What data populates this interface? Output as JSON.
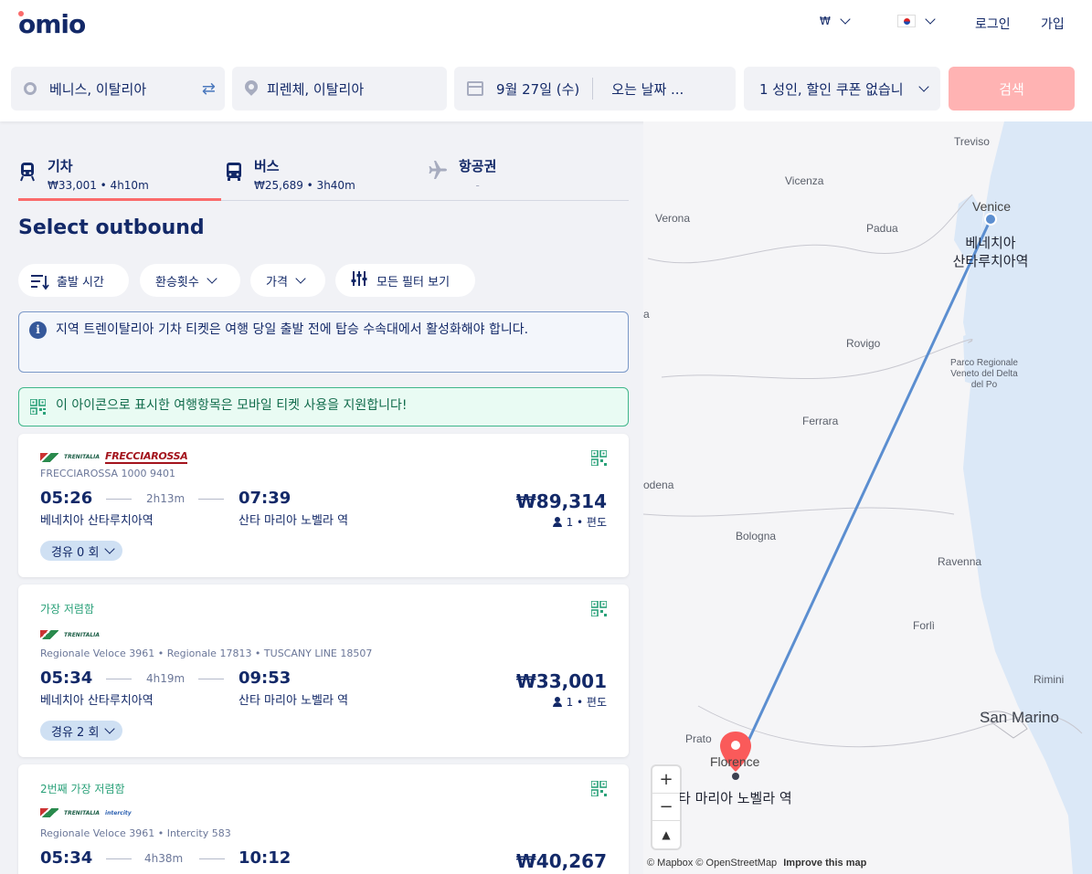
{
  "header": {
    "logo": "omio",
    "currency": "₩",
    "login": "로그인",
    "signup": "가입"
  },
  "search": {
    "origin": "베니스, 이탈리아",
    "destination": "피렌체, 이탈리아",
    "depart_date": "9월 27일 (수)",
    "return_date": "오는 날짜 ...",
    "passengers": "1 성인, 할인 쿠폰 없습니",
    "button": "검색"
  },
  "tabs": [
    {
      "label": "기차",
      "sub": "₩33,001 • 4h10m",
      "icon": "train-icon"
    },
    {
      "label": "버스",
      "sub": "₩25,689 • 3h40m",
      "icon": "bus-icon"
    },
    {
      "label": "항공권",
      "sub": "-",
      "icon": "plane-icon"
    }
  ],
  "section_title": "Select outbound",
  "filters": {
    "departure_time": "출발 시간",
    "transfers": "환승횟수",
    "price": "가격",
    "all_filters": "모든 필터 보기"
  },
  "notices": {
    "info": "지역 트렌이탈리아 기차 티켓은 여행 당일 출발 전에 탑승 수속대에서 활성화해야 합니다.",
    "mobile": "이 아이콘으로 표시한 여행항목은 모바일 티켓 사용을 지원합니다!"
  },
  "results": [
    {
      "tag": "",
      "operator": "FRECCIAROSSA",
      "train": "FRECCIAROSSA 1000 9401",
      "depart": "05:26",
      "duration": "2h13m",
      "arrive": "07:39",
      "from": "베네치아 산타루치아역",
      "to": "산타 마리아 노벨라 역",
      "price": "₩89,314",
      "pax": "1 • 편도",
      "stops": "경유 0 회"
    },
    {
      "tag": "가장 저렴함",
      "operator": "",
      "train": "Regionale Veloce 3961 • Regionale 17813 • TUSCANY LINE 18507",
      "depart": "05:34",
      "duration": "4h19m",
      "arrive": "09:53",
      "from": "베네치아 산타루치아역",
      "to": "산타 마리아 노벨라 역",
      "price": "₩33,001",
      "pax": "1 • 편도",
      "stops": "경유 2 회"
    },
    {
      "tag": "2번째 가장 저렴함",
      "operator": "",
      "train": "Regionale Veloce 3961 • Intercity 583",
      "depart": "05:34",
      "duration": "4h38m",
      "arrive": "10:12",
      "price": "₩40,267"
    }
  ],
  "map": {
    "cities": {
      "treviso": "Treviso",
      "vicenza": "Vicenza",
      "venice": "Venice",
      "verona": "Verona",
      "padua": "Padua",
      "rovigo": "Rovigo",
      "parco": "Parco Regionale Veneto del Delta del Po",
      "ferrara": "Ferrara",
      "modena": "odena",
      "bologna": "Bologna",
      "ravenna": "Ravenna",
      "forli": "Forlì",
      "rimini": "Rimini",
      "san_marino": "San Marino",
      "prato": "Prato",
      "florence": "Florence",
      "edge_a": "a"
    },
    "origin_label_1": "베네치아",
    "origin_label_2": "산타루치아역",
    "dest_label": "타 마리아 노벨라 역",
    "zoom_in": "+",
    "zoom_out": "−",
    "compass": "▲",
    "attribution_1": "© Mapbox",
    "attribution_2": "© OpenStreetMap",
    "attribution_3": "Improve this map"
  },
  "colors": {
    "navy": "#132968",
    "accent": "#fa6b6b",
    "search_button": "#ffb3b3",
    "route": "#5b8ed0"
  }
}
